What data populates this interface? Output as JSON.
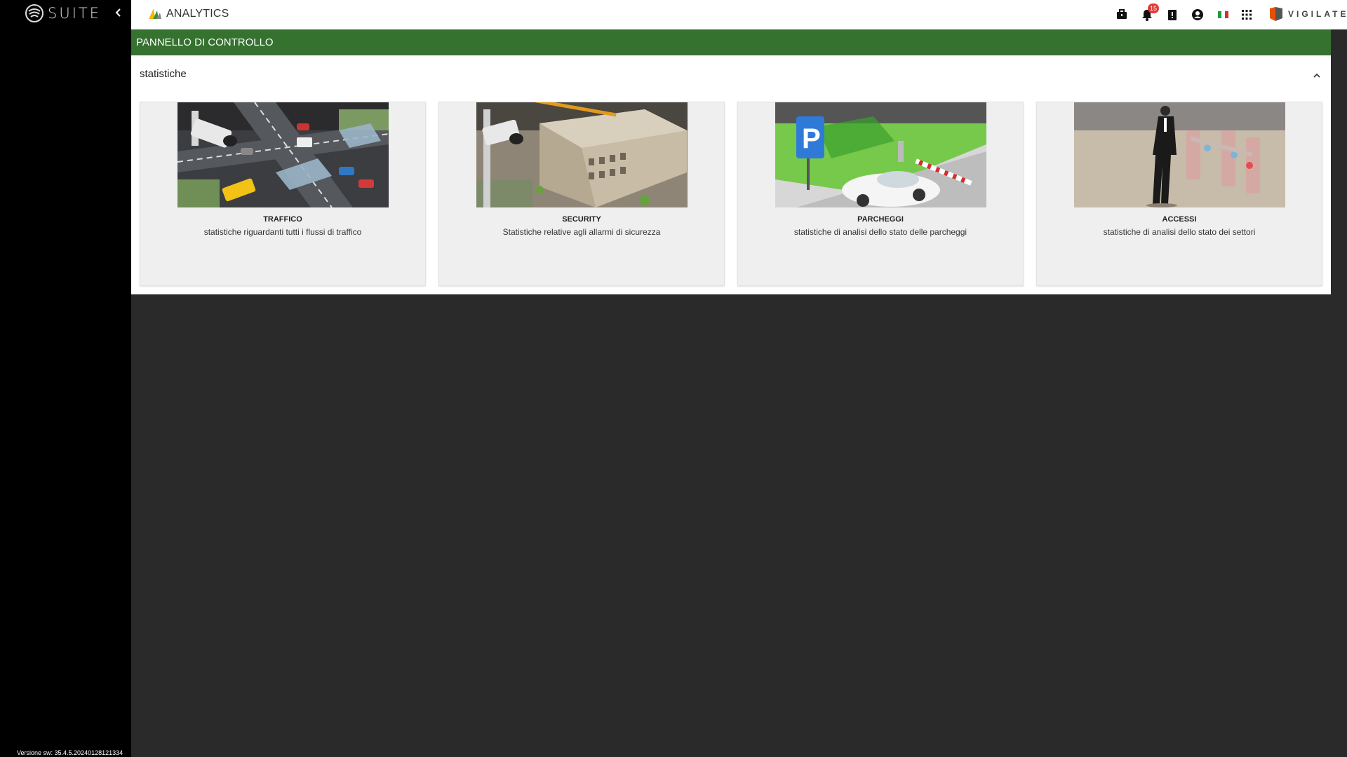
{
  "sidebar": {
    "brand": "SUITE",
    "version": "Versione sw: 35.4.5.20240128121334"
  },
  "topbar": {
    "app_title": "ANALYTICS",
    "notifications_count": "15",
    "logo_text": "VIGILATE"
  },
  "page": {
    "header": "PANNELLO DI CONTROLLO"
  },
  "panel": {
    "title": "statistiche",
    "cards": [
      {
        "title": "TRAFFICO",
        "description": "statistiche riguardanti tutti i flussi di traffico"
      },
      {
        "title": "SECURITY",
        "description": "Statistiche relative agli allarmi di sicurezza"
      },
      {
        "title": "PARCHEGGI",
        "description": "statistiche di analisi dello stato delle parcheggi"
      },
      {
        "title": "ACCESSI",
        "description": "statistiche di analisi dello stato dei settori"
      }
    ]
  },
  "colors": {
    "header_green": "#35712f",
    "sidebar": "#000000",
    "background": "#2a2a2a",
    "badge": "#e53935"
  }
}
